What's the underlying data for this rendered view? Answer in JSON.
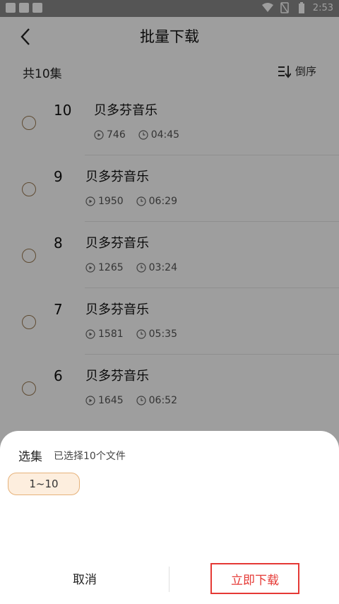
{
  "status_bar": {
    "time": "2:53"
  },
  "header": {
    "title": "批量下载"
  },
  "summary": {
    "count_text": "共10集",
    "sort_label": "倒序"
  },
  "episodes": [
    {
      "num": "10",
      "title": "贝多芬音乐",
      "plays": "746",
      "duration": "04:45"
    },
    {
      "num": "9",
      "title": "贝多芬音乐",
      "plays": "1950",
      "duration": "06:29"
    },
    {
      "num": "8",
      "title": "贝多芬音乐",
      "plays": "1265",
      "duration": "03:24"
    },
    {
      "num": "7",
      "title": "贝多芬音乐",
      "plays": "1581",
      "duration": "05:35"
    },
    {
      "num": "6",
      "title": "贝多芬音乐",
      "plays": "1645",
      "duration": "06:52"
    }
  ],
  "sheet": {
    "title": "选集",
    "subtitle": "已选择10个文件",
    "range_chip": "1~10",
    "cancel_label": "取消",
    "download_label": "立即下载"
  },
  "colors": {
    "accent": "#e53935",
    "chip_bg": "#fdeede",
    "chip_border": "#e6b27a",
    "radio": "#9a7a52"
  }
}
